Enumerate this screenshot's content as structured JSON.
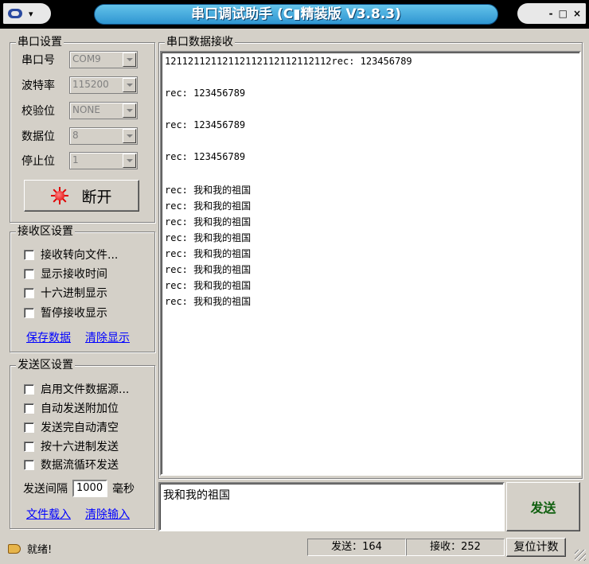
{
  "window": {
    "title": "串口调试助手 (C▮精装版 V3.8.3)",
    "controls": [
      "-",
      "□",
      "×"
    ]
  },
  "serial_settings": {
    "title": "串口设置",
    "fields": [
      {
        "label": "串口号",
        "value": "COM9"
      },
      {
        "label": "波特率",
        "value": "115200"
      },
      {
        "label": "校验位",
        "value": "NONE"
      },
      {
        "label": "数据位",
        "value": "8"
      },
      {
        "label": "停止位",
        "value": "1"
      }
    ],
    "connect_button": "断开",
    "led_color": "#e00000"
  },
  "receive_settings": {
    "title": "接收区设置",
    "options": [
      "接收转向文件...",
      "显示接收时间",
      "十六进制显示",
      "暂停接收显示"
    ],
    "save_link": "保存数据",
    "clear_link": "清除显示"
  },
  "send_settings": {
    "title": "发送区设置",
    "options": [
      "启用文件数据源...",
      "自动发送附加位",
      "发送完自动清空",
      "按十六进制发送",
      "数据流循环发送"
    ],
    "interval_label": "发送间隔",
    "interval_value": "1000",
    "interval_unit": "毫秒",
    "load_link": "文件载入",
    "clear_link": "清除输入"
  },
  "receive_area": {
    "title": "串口数据接收",
    "lines": [
      "12112112112112112112112112112rec: 123456789",
      "rec: 123456789",
      "rec: 123456789",
      "rec: 123456789",
      "rec: 我和我的祖国",
      "rec: 我和我的祖国",
      "rec: 我和我的祖国",
      "rec: 我和我的祖国",
      "rec: 我和我的祖国",
      "rec: 我和我的祖国",
      "rec: 我和我的祖国",
      "rec: 我和我的祖国"
    ]
  },
  "send_area": {
    "text": "我和我的祖国",
    "send_button": "发送"
  },
  "status": {
    "ready": "就绪!",
    "sent": "发送：164",
    "received": "接收：252",
    "reset_button": "复位计数"
  }
}
